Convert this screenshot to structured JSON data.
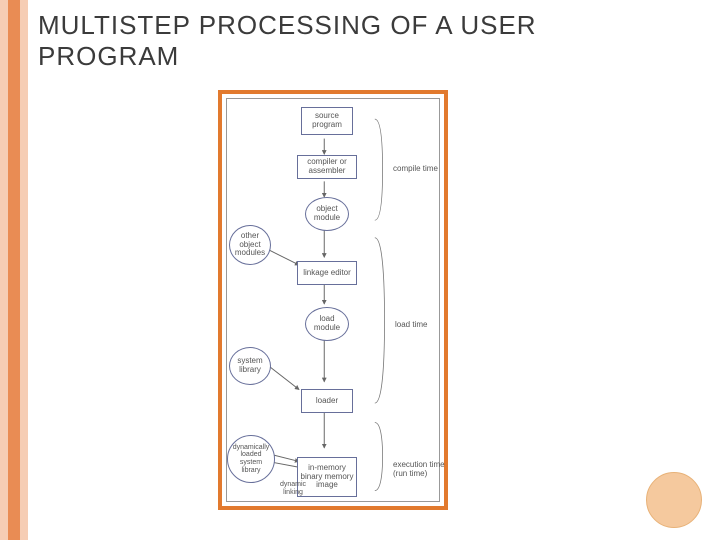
{
  "slide": {
    "title": "MULTISTEP PROCESSING OF A USER PROGRAM"
  },
  "nodes": {
    "source": {
      "label": "source\nprogram"
    },
    "compiler": {
      "label": "compiler or\nassembler"
    },
    "object": {
      "label": "object\nmodule"
    },
    "other_obj": {
      "label": "other\nobject\nmodules"
    },
    "linkage": {
      "label": "linkage\neditor"
    },
    "load_module": {
      "label": "load\nmodule"
    },
    "syslib": {
      "label": "system\nlibrary"
    },
    "loader": {
      "label": "loader"
    },
    "dynlib": {
      "label": "dynamically\nloaded\nsystem\nlibrary"
    },
    "dynlink_label": {
      "label": "dynamic\nlinking"
    },
    "memimage": {
      "label": "in-memory\nbinary\nmemory\nimage"
    }
  },
  "phases": {
    "compile": {
      "label": "compile\ntime"
    },
    "load": {
      "label": "load\ntime"
    },
    "exec": {
      "label": "execution\ntime (run\ntime)"
    }
  }
}
